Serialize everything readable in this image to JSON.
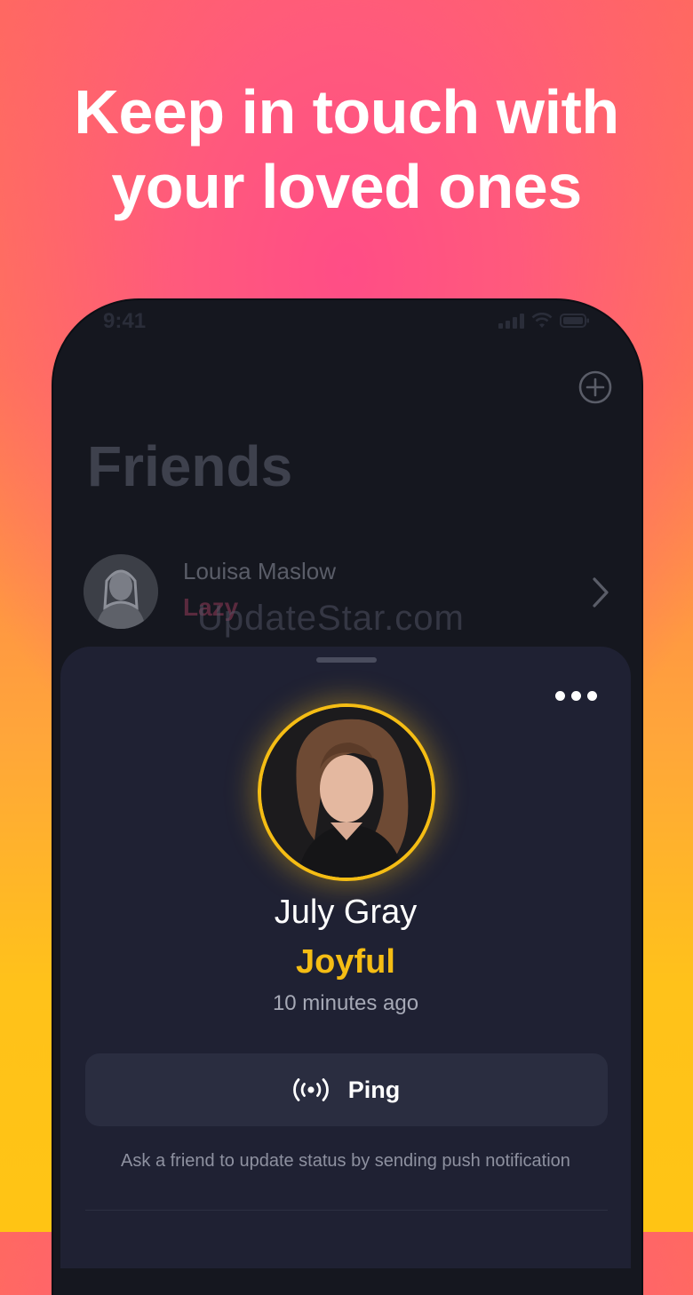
{
  "headline": {
    "line1": "Keep in touch with",
    "line2": "your loved ones"
  },
  "status_bar": {
    "time": "9:41",
    "icons": [
      "cellular-icon",
      "wifi-icon",
      "battery-icon"
    ]
  },
  "friends_screen": {
    "title": "Friends",
    "add_icon": "plus-circle-icon",
    "friend": {
      "name": "Louisa Maslow",
      "status": "Lazy",
      "chevron_icon": "chevron-right-icon"
    }
  },
  "watermark": "UpdateStar.com",
  "sheet": {
    "more_icon": "more-dots-icon",
    "name": "July Gray",
    "mood": "Joyful",
    "time_ago": "10 minutes ago",
    "ping_label": "Ping",
    "ping_icon": "broadcast-icon",
    "hint": "Ask a friend to update status by sending push notification"
  },
  "colors": {
    "accent_gold": "#f5bd14",
    "sheet_bg": "#1f2133",
    "phone_bg": "#15171f",
    "bg_pink": "#ff5a7c",
    "bg_yellow": "#ffc414"
  }
}
